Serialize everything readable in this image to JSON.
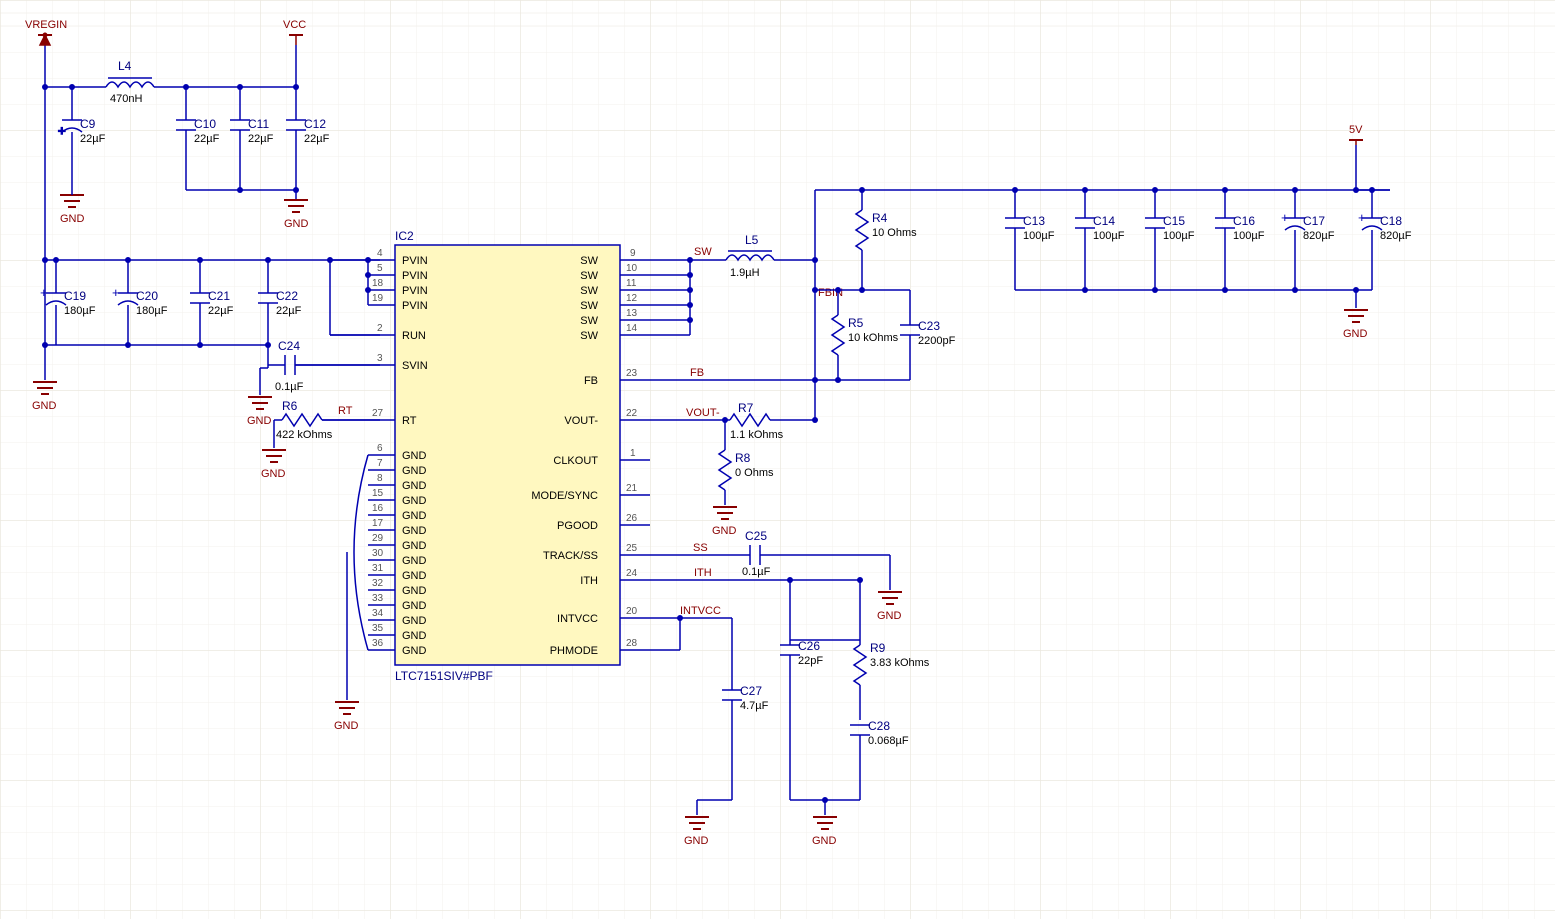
{
  "power": {
    "vregin": "VREGIN",
    "vcc": "VCC",
    "v5": "5V",
    "gnd": "GND"
  },
  "nets": {
    "SW": "SW",
    "FBIN": "FBIN",
    "FB": "FB",
    "VOUT_NEG": "VOUT-",
    "SS": "SS",
    "ITH": "ITH",
    "INTVCC": "INTVCC",
    "RT": "RT"
  },
  "ic": {
    "ref": "IC2",
    "name": "LTC7151SIV#PBF",
    "pins_left": [
      {
        "num": "4",
        "label": "PVIN"
      },
      {
        "num": "5",
        "label": "PVIN"
      },
      {
        "num": "18",
        "label": "PVIN"
      },
      {
        "num": "19",
        "label": "PVIN"
      },
      {
        "num": "2",
        "label": "RUN"
      },
      {
        "num": "3",
        "label": "SVIN"
      },
      {
        "num": "27",
        "label": "RT"
      },
      {
        "num": "6",
        "label": "GND"
      },
      {
        "num": "7",
        "label": "GND"
      },
      {
        "num": "8",
        "label": "GND"
      },
      {
        "num": "15",
        "label": "GND"
      },
      {
        "num": "16",
        "label": "GND"
      },
      {
        "num": "17",
        "label": "GND"
      },
      {
        "num": "29",
        "label": "GND"
      },
      {
        "num": "30",
        "label": "GND"
      },
      {
        "num": "31",
        "label": "GND"
      },
      {
        "num": "32",
        "label": "GND"
      },
      {
        "num": "33",
        "label": "GND"
      },
      {
        "num": "34",
        "label": "GND"
      },
      {
        "num": "35",
        "label": "GND"
      },
      {
        "num": "36",
        "label": "GND"
      }
    ],
    "pins_right": [
      {
        "num": "9",
        "label": "SW"
      },
      {
        "num": "10",
        "label": "SW"
      },
      {
        "num": "11",
        "label": "SW"
      },
      {
        "num": "12",
        "label": "SW"
      },
      {
        "num": "13",
        "label": "SW"
      },
      {
        "num": "14",
        "label": "SW"
      },
      {
        "num": "23",
        "label": "FB"
      },
      {
        "num": "22",
        "label": "VOUT-"
      },
      {
        "num": "1",
        "label": "CLKOUT"
      },
      {
        "num": "21",
        "label": "MODE/SYNC"
      },
      {
        "num": "26",
        "label": "PGOOD"
      },
      {
        "num": "25",
        "label": "TRACK/SS"
      },
      {
        "num": "24",
        "label": "ITH"
      },
      {
        "num": "20",
        "label": "INTVCC"
      },
      {
        "num": "28",
        "label": "PHMODE"
      }
    ]
  },
  "components": {
    "L4": {
      "ref": "L4",
      "val": "470nH"
    },
    "L5": {
      "ref": "L5",
      "val": "1.9µH"
    },
    "C9": {
      "ref": "C9",
      "val": "22µF"
    },
    "C10": {
      "ref": "C10",
      "val": "22µF"
    },
    "C11": {
      "ref": "C11",
      "val": "22µF"
    },
    "C12": {
      "ref": "C12",
      "val": "22µF"
    },
    "C13": {
      "ref": "C13",
      "val": "100µF"
    },
    "C14": {
      "ref": "C14",
      "val": "100µF"
    },
    "C15": {
      "ref": "C15",
      "val": "100µF"
    },
    "C16": {
      "ref": "C16",
      "val": "100µF"
    },
    "C17": {
      "ref": "C17",
      "val": "820µF"
    },
    "C18": {
      "ref": "C18",
      "val": "820µF"
    },
    "C19": {
      "ref": "C19",
      "val": "180µF"
    },
    "C20": {
      "ref": "C20",
      "val": "180µF"
    },
    "C21": {
      "ref": "C21",
      "val": "22µF"
    },
    "C22": {
      "ref": "C22",
      "val": "22µF"
    },
    "C23": {
      "ref": "C23",
      "val": "2200pF"
    },
    "C24": {
      "ref": "C24",
      "val": "0.1µF"
    },
    "C25": {
      "ref": "C25",
      "val": "0.1µF"
    },
    "C26": {
      "ref": "C26",
      "val": "22pF"
    },
    "C27": {
      "ref": "C27",
      "val": "4.7µF"
    },
    "C28": {
      "ref": "C28",
      "val": "0.068µF"
    },
    "R4": {
      "ref": "R4",
      "val": "10 Ohms"
    },
    "R5": {
      "ref": "R5",
      "val": "10 kOhms"
    },
    "R6": {
      "ref": "R6",
      "val": "422 kOhms"
    },
    "R7": {
      "ref": "R7",
      "val": "1.1 kOhms"
    },
    "R8": {
      "ref": "R8",
      "val": "0 Ohms"
    },
    "R9": {
      "ref": "R9",
      "val": "3.83 kOhms"
    }
  }
}
